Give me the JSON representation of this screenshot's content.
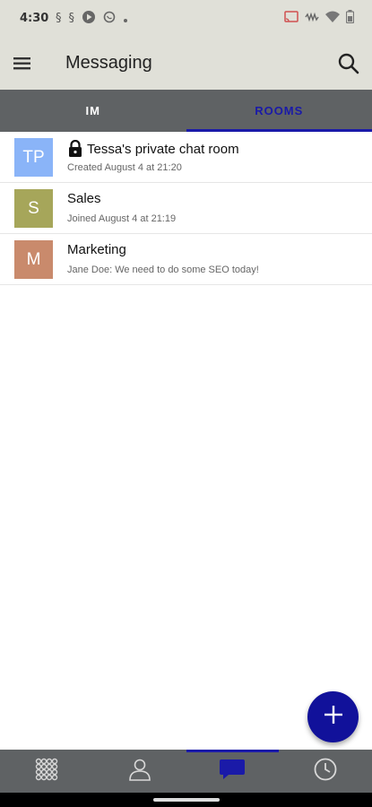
{
  "status_bar": {
    "time": "4:30",
    "left_icons": [
      "notification-icon",
      "notification-icon",
      "play-icon",
      "whatsapp-icon",
      "dot-icon"
    ],
    "right_icons": [
      "cast-icon",
      "vibrate-icon",
      "wifi-icon",
      "battery-icon"
    ]
  },
  "app_bar": {
    "title": "Messaging"
  },
  "tabs": [
    {
      "label": "IM",
      "active": false
    },
    {
      "label": "ROOMS",
      "active": true
    }
  ],
  "rooms": [
    {
      "initials": "TP",
      "avatar_color": "#8ab4f8",
      "locked": true,
      "name": "Tessa's private chat room",
      "subtitle": "Created August 4 at 21:20"
    },
    {
      "initials": "S",
      "avatar_color": "#a6a65a",
      "locked": false,
      "name": "Sales",
      "subtitle": "Joined August 4 at 21:19"
    },
    {
      "initials": "M",
      "avatar_color": "#c98a6c",
      "locked": false,
      "name": "Marketing",
      "subtitle": "Jane Doe: We need to do some SEO today!"
    }
  ],
  "bottom_nav": [
    {
      "icon": "dialpad-icon",
      "active": false
    },
    {
      "icon": "contacts-icon",
      "active": false
    },
    {
      "icon": "chat-icon",
      "active": true
    },
    {
      "icon": "history-icon",
      "active": false
    }
  ],
  "colors": {
    "accent": "#1a1aa8",
    "fab": "#11119a",
    "header_bg": "#e0e0d8",
    "nav_bg": "#5f6264"
  }
}
